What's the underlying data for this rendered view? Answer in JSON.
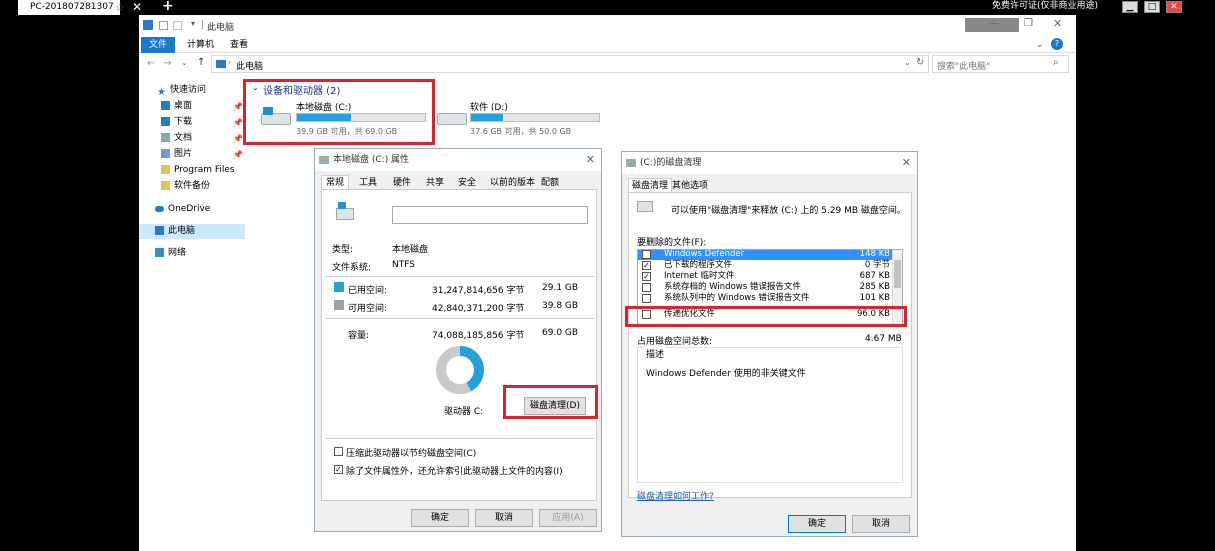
{
  "remote": {
    "tab_title": "PC-201807281307",
    "license_text": "免费许可证(仅非商业用途)",
    "min": "▁",
    "max": "□",
    "close": "✕"
  },
  "explorer": {
    "title": "此电脑",
    "ribbon_tabs": [
      "文件",
      "计算机",
      "查看"
    ],
    "address": "此电脑",
    "search_placeholder": "搜索\"此电脑\"",
    "nav": [
      "快速访问",
      "桌面",
      "下载",
      "文档",
      "图片",
      "Program Files",
      "软件备份",
      "OneDrive",
      "此电脑",
      "网络"
    ],
    "section_header": "设备和驱动器 (2)",
    "drives": [
      {
        "name": "本地磁盘 (C:)",
        "space": "39.9 GB 可用，共 69.0 GB",
        "used_fraction": 0.42
      },
      {
        "name": "软件 (D:)",
        "space": "37.6 GB 可用，共 50.0 GB",
        "used_fraction": 0.25
      }
    ]
  },
  "props": {
    "title": "本地磁盘 (C:) 属性",
    "tabs": [
      "常规",
      "工具",
      "硬件",
      "共享",
      "安全",
      "以前的版本",
      "配额"
    ],
    "name_value": "",
    "type_label": "类型:",
    "type_value": "本地磁盘",
    "fs_label": "文件系统:",
    "fs_value": "NTFS",
    "used_label": "已用空间:",
    "used_bytes": "31,247,814,656 字节",
    "used_gb": "29.1 GB",
    "free_label": "可用空间:",
    "free_bytes": "42,840,371,200 字节",
    "free_gb": "39.8 GB",
    "cap_label": "容量:",
    "cap_bytes": "74,088,185,856 字节",
    "cap_gb": "69.0 GB",
    "drive_label": "驱动器 C:",
    "cleanup_button": "磁盘清理(D)",
    "compress_label": "压缩此驱动器以节约磁盘空间(C)",
    "index_label": "除了文件属性外，还允许索引此驱动器上文件的内容(I)",
    "ok": "确定",
    "cancel": "取消",
    "apply": "应用(A)",
    "used_color": "#26a0da",
    "free_color": "#c9c9c9"
  },
  "cleanup": {
    "title": "(C:)的磁盘清理",
    "tabs": [
      "磁盘清理",
      "其他选项"
    ],
    "intro": "可以使用\"磁盘清理\"来释放 (C:) 上的 5.29 MB 磁盘空间。",
    "list_label": "要删除的文件(F):",
    "items": [
      {
        "name": "Windows Defender",
        "size": "148 KB",
        "checked": false
      },
      {
        "name": "已下载的程序文件",
        "size": "0 字节",
        "checked": true
      },
      {
        "name": "Internet 临时文件",
        "size": "687 KB",
        "checked": true
      },
      {
        "name": "系统存档的 Windows 错误报告文件",
        "size": "285 KB",
        "checked": false
      },
      {
        "name": "系统队列中的 Windows 错误报告文件",
        "size": "101 KB",
        "checked": false
      },
      {
        "name": "传递优化文件",
        "size": "96.0 KB",
        "checked": false
      }
    ],
    "total_label": "占用磁盘空间总数:",
    "total_value": "4.67 MB",
    "desc_label": "描述",
    "desc_text": "Windows Defender 使用的非关键文件",
    "link": "磁盘清理如何工作?",
    "ok": "确定",
    "cancel": "取消"
  }
}
